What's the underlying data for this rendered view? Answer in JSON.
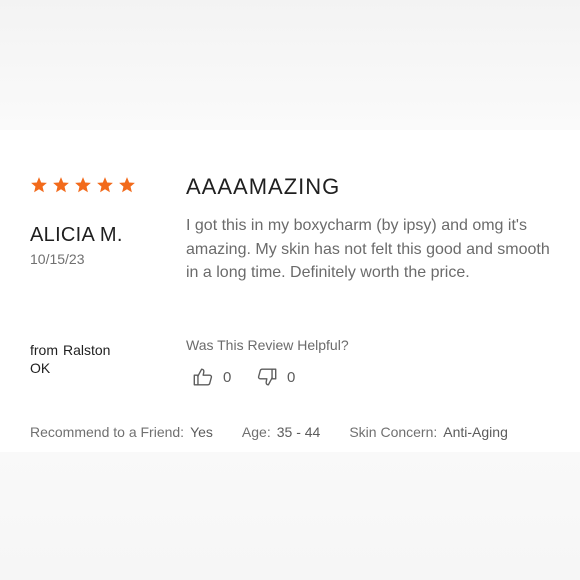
{
  "review": {
    "rating": 5,
    "rating_max": 5,
    "star_color": "#f26a1b",
    "reviewer_name": "ALICIA M.",
    "date": "10/15/23",
    "location_label": "from",
    "location_city": "Ralston",
    "location_state": "OK",
    "title": "AAAAMAZING",
    "body": "I got this in my boxycharm (by ipsy) and omg it's amazing. My skin has not felt this good and smooth in a long time. Definitely worth the price.",
    "helpful_question": "Was This Review Helpful?",
    "helpful_yes_count": "0",
    "helpful_no_count": "0",
    "helpful_icons": [
      "thumbs-up-icon",
      "thumbs-down-icon"
    ]
  },
  "meta": {
    "recommend_label": "Recommend to a Friend:",
    "recommend_value": "Yes",
    "age_label": "Age:",
    "age_value": "35 - 44",
    "skin_label": "Skin Concern:",
    "skin_value": "Anti-Aging"
  }
}
